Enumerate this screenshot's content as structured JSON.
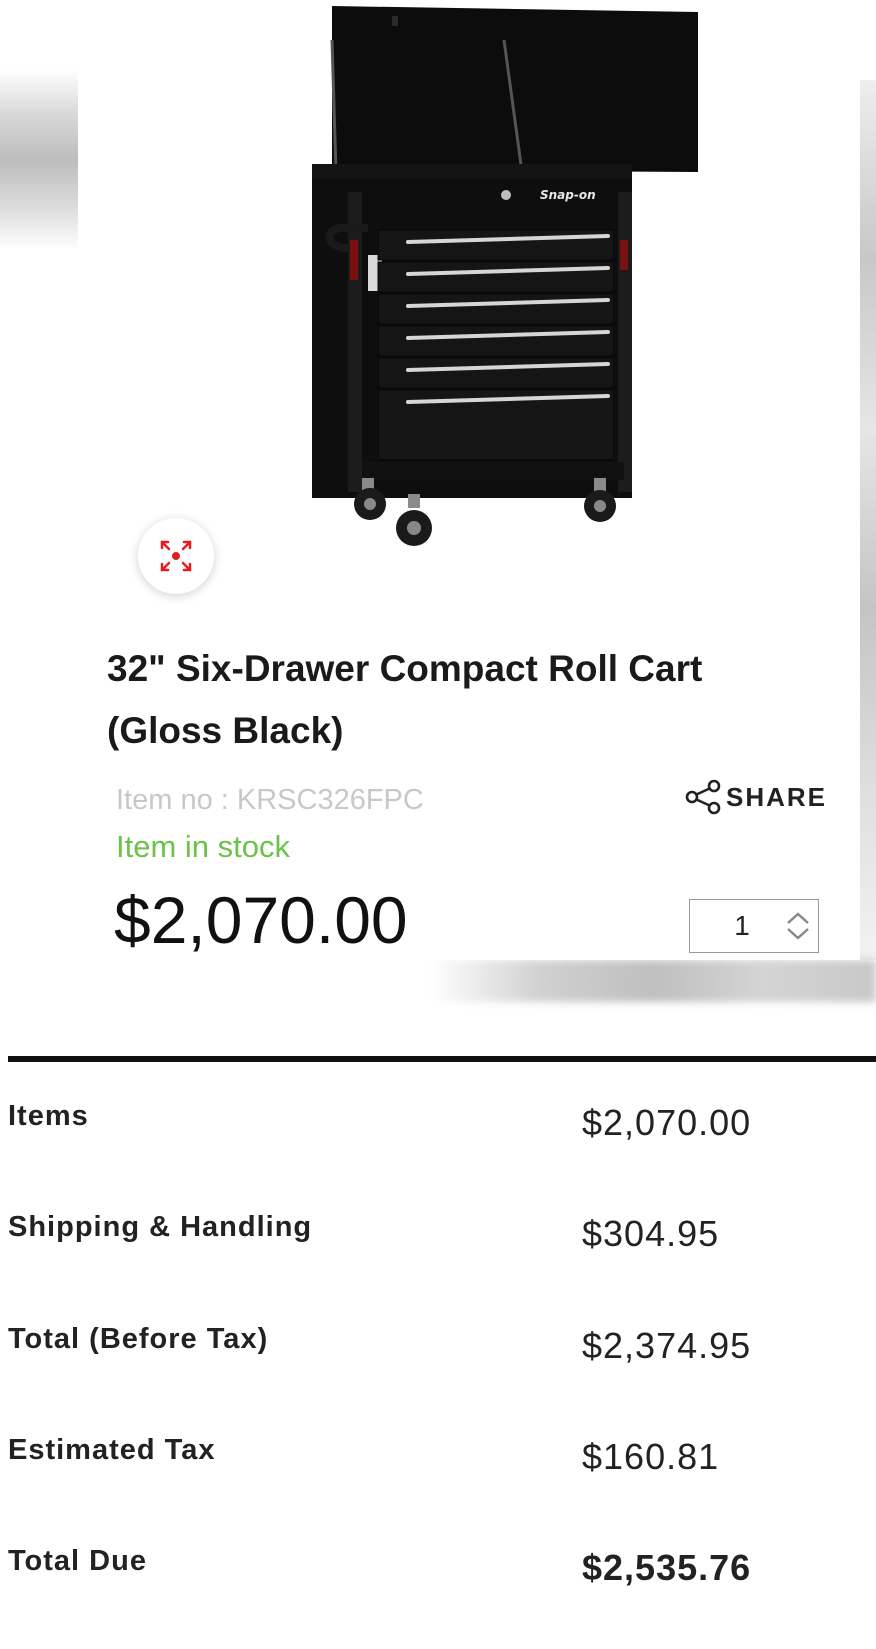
{
  "product": {
    "image_alt": "Snap-on six-drawer roll cart",
    "brand_on_product": "Snap-on",
    "title": "32\" Six-Drawer Compact Roll Cart (Gloss Black)",
    "item_number": "Item no : KRSC326FPC",
    "stock_status": "Item in stock",
    "price": "$2,070.00",
    "share_label": "SHARE",
    "quantity": "1"
  },
  "summary": [
    {
      "label": "Items",
      "value": "$2,070.00"
    },
    {
      "label": "Shipping & Handling",
      "value": "$304.95"
    },
    {
      "label": "Total (Before Tax)",
      "value": "$2,374.95"
    },
    {
      "label": "Estimated Tax",
      "value": "$160.81"
    },
    {
      "label": "Total Due",
      "value": "$2,535.76"
    }
  ],
  "colors": {
    "stock_green": "#6cc24a",
    "expand_icon_red": "#e02020",
    "text_dark": "#1a1a1a",
    "item_no_gray": "#c8c8c8"
  },
  "icons": [
    "expand-icon",
    "share-icon",
    "chevron-up-icon",
    "chevron-down-icon"
  ]
}
